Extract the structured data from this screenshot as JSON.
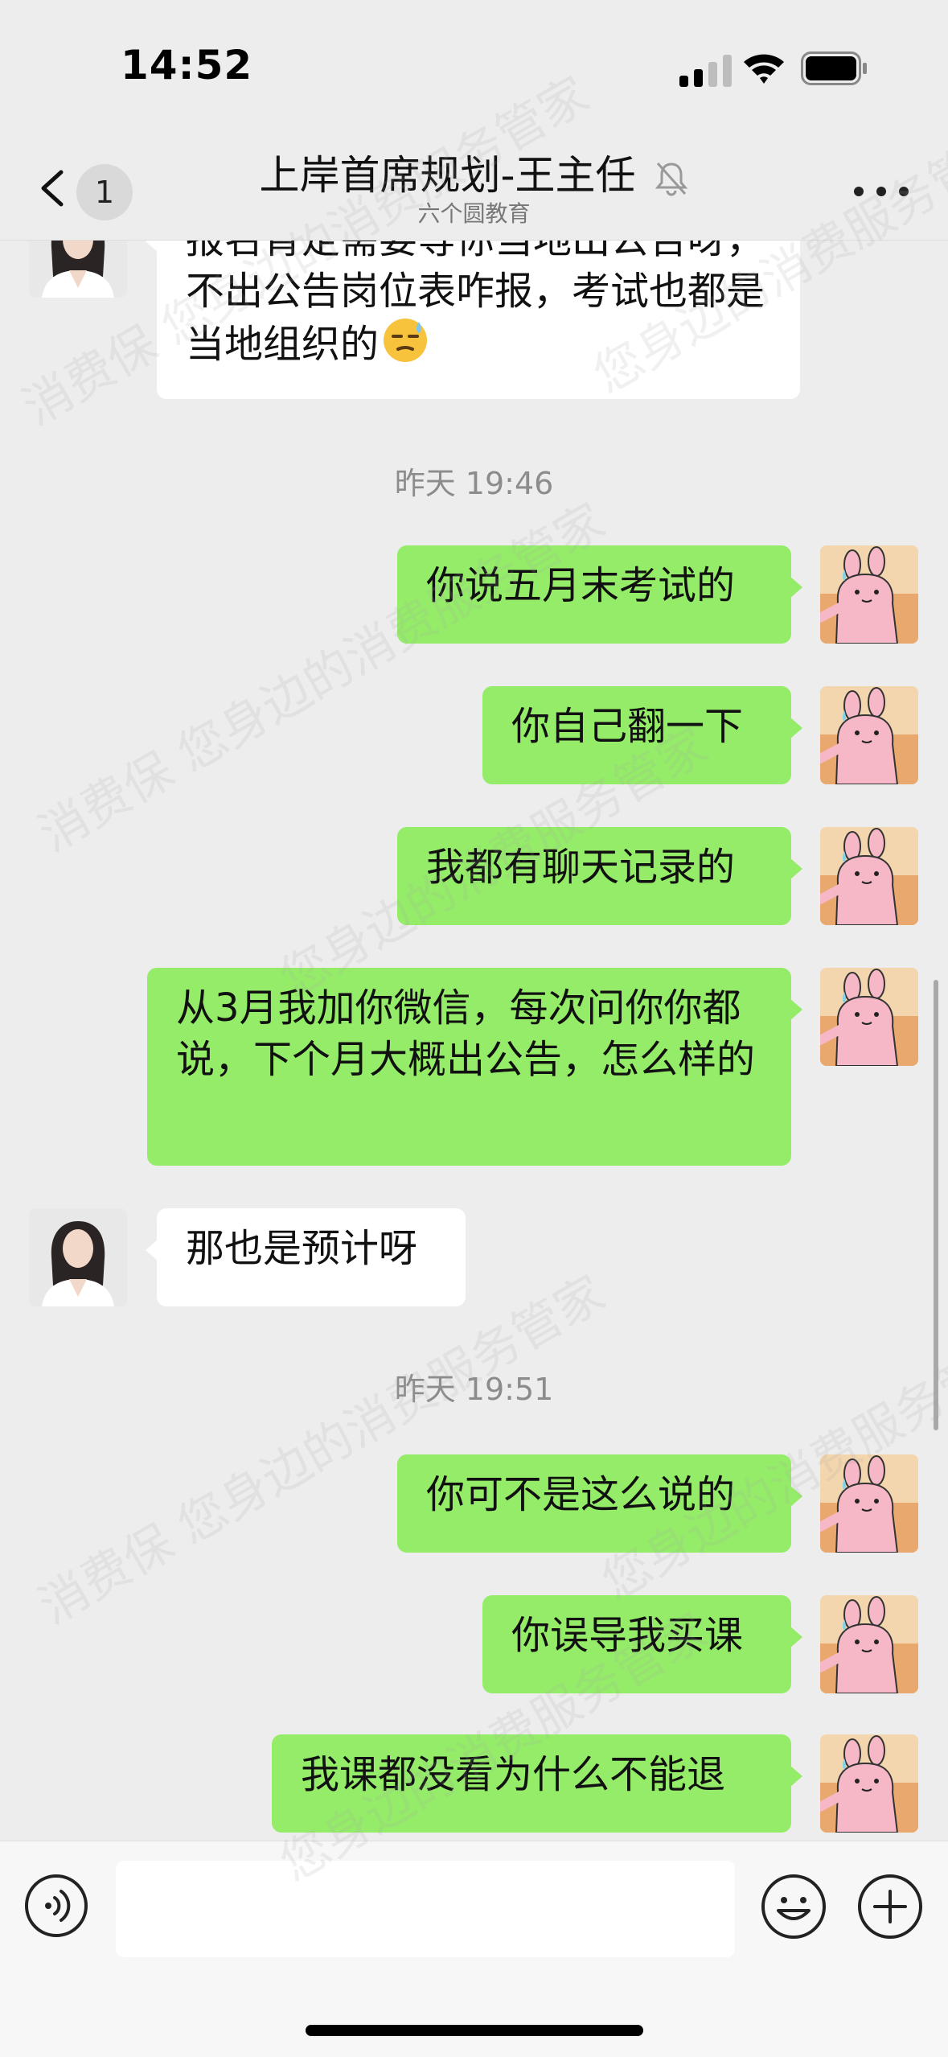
{
  "status_bar": {
    "time": "14:52"
  },
  "header": {
    "back_badge": "1",
    "title": "上岸首席规划-王主任",
    "subtitle": "六个圆教育"
  },
  "messages": [
    {
      "side": "in",
      "text": "报名肯定需要等你当地出公告呀，不出公告岗位表咋报，考试也都是当地组织的",
      "emoji": "downcast-sweat-face"
    },
    {
      "type": "timestamp",
      "text": "昨天 19:46"
    },
    {
      "side": "out",
      "text": "你说五月末考试的"
    },
    {
      "side": "out",
      "text": "你自己翻一下"
    },
    {
      "side": "out",
      "text": "我都有聊天记录的"
    },
    {
      "side": "out",
      "text": "从3月我加你微信，每次问你你都说，下个月大概出公告，怎么样的"
    },
    {
      "side": "in",
      "text": "那也是预计呀"
    },
    {
      "type": "timestamp",
      "text": "昨天 19:51"
    },
    {
      "side": "out",
      "text": "你可不是这么说的"
    },
    {
      "side": "out",
      "text": "你误导我买课"
    },
    {
      "side": "out",
      "text": "我课都没看为什么不能退"
    }
  ],
  "watermark": [
    "消费保",
    "您身边的消费服务管家"
  ],
  "input_bar": {
    "value": ""
  },
  "icons": {
    "back": "chevron-left-icon",
    "mute": "bell-off-icon",
    "more": "more-dots-icon",
    "voice": "voice-icon",
    "emoji": "smile-icon",
    "plus": "plus-icon"
  },
  "colors": {
    "background": "#ededed",
    "outgoing_bubble": "#95ec69",
    "incoming_bubble": "#ffffff"
  }
}
